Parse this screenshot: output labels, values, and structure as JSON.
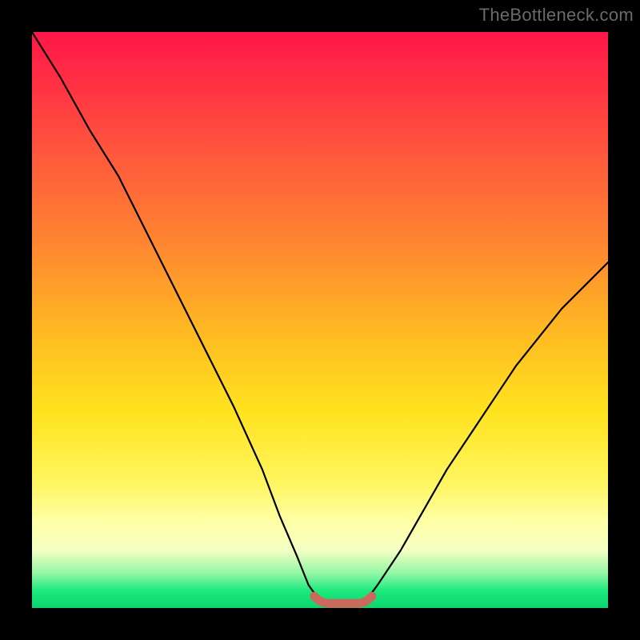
{
  "watermark": {
    "text": "TheBottleneck.com"
  },
  "colors": {
    "curve_stroke": "#000000",
    "bottom_marker": "#c96a5d",
    "frame_bg": "#000000"
  },
  "chart_data": {
    "type": "line",
    "title": "",
    "xlabel": "",
    "ylabel": "",
    "xlim": [
      0,
      100
    ],
    "ylim": [
      0,
      100
    ],
    "grid": false,
    "legend": false,
    "series": [
      {
        "name": "bottleneck-curve",
        "x": [
          0,
          5,
          10,
          15,
          20,
          25,
          30,
          35,
          40,
          43,
          46,
          48,
          50,
          52,
          54,
          56,
          58,
          60,
          64,
          68,
          72,
          76,
          80,
          84,
          88,
          92,
          96,
          100
        ],
        "y": [
          100,
          92,
          83,
          75,
          65,
          55,
          45,
          35,
          24,
          16,
          9,
          4,
          1.2,
          0.5,
          0.5,
          0.5,
          1.3,
          4,
          10,
          17,
          24,
          30,
          36,
          42,
          47,
          52,
          56,
          60
        ]
      }
    ],
    "annotations": [
      {
        "name": "optimal-region-marker",
        "xstart": 49,
        "xend": 59,
        "y": 0.8,
        "style": "thick-coral"
      }
    ]
  }
}
